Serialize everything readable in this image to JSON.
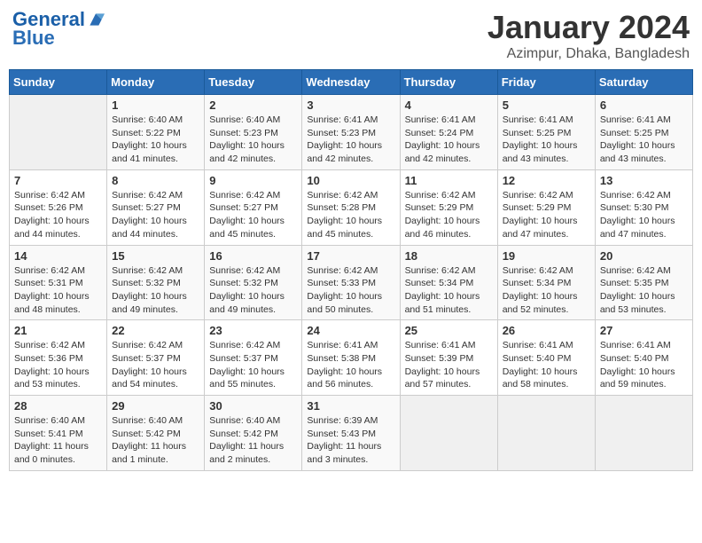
{
  "header": {
    "logo_line1": "General",
    "logo_line2": "Blue",
    "main_title": "January 2024",
    "subtitle": "Azimpur, Dhaka, Bangladesh"
  },
  "weekdays": [
    "Sunday",
    "Monday",
    "Tuesday",
    "Wednesday",
    "Thursday",
    "Friday",
    "Saturday"
  ],
  "weeks": [
    [
      {
        "day": "",
        "info": ""
      },
      {
        "day": "1",
        "info": "Sunrise: 6:40 AM\nSunset: 5:22 PM\nDaylight: 10 hours\nand 41 minutes."
      },
      {
        "day": "2",
        "info": "Sunrise: 6:40 AM\nSunset: 5:23 PM\nDaylight: 10 hours\nand 42 minutes."
      },
      {
        "day": "3",
        "info": "Sunrise: 6:41 AM\nSunset: 5:23 PM\nDaylight: 10 hours\nand 42 minutes."
      },
      {
        "day": "4",
        "info": "Sunrise: 6:41 AM\nSunset: 5:24 PM\nDaylight: 10 hours\nand 42 minutes."
      },
      {
        "day": "5",
        "info": "Sunrise: 6:41 AM\nSunset: 5:25 PM\nDaylight: 10 hours\nand 43 minutes."
      },
      {
        "day": "6",
        "info": "Sunrise: 6:41 AM\nSunset: 5:25 PM\nDaylight: 10 hours\nand 43 minutes."
      }
    ],
    [
      {
        "day": "7",
        "info": "Sunrise: 6:42 AM\nSunset: 5:26 PM\nDaylight: 10 hours\nand 44 minutes."
      },
      {
        "day": "8",
        "info": "Sunrise: 6:42 AM\nSunset: 5:27 PM\nDaylight: 10 hours\nand 44 minutes."
      },
      {
        "day": "9",
        "info": "Sunrise: 6:42 AM\nSunset: 5:27 PM\nDaylight: 10 hours\nand 45 minutes."
      },
      {
        "day": "10",
        "info": "Sunrise: 6:42 AM\nSunset: 5:28 PM\nDaylight: 10 hours\nand 45 minutes."
      },
      {
        "day": "11",
        "info": "Sunrise: 6:42 AM\nSunset: 5:29 PM\nDaylight: 10 hours\nand 46 minutes."
      },
      {
        "day": "12",
        "info": "Sunrise: 6:42 AM\nSunset: 5:29 PM\nDaylight: 10 hours\nand 47 minutes."
      },
      {
        "day": "13",
        "info": "Sunrise: 6:42 AM\nSunset: 5:30 PM\nDaylight: 10 hours\nand 47 minutes."
      }
    ],
    [
      {
        "day": "14",
        "info": "Sunrise: 6:42 AM\nSunset: 5:31 PM\nDaylight: 10 hours\nand 48 minutes."
      },
      {
        "day": "15",
        "info": "Sunrise: 6:42 AM\nSunset: 5:32 PM\nDaylight: 10 hours\nand 49 minutes."
      },
      {
        "day": "16",
        "info": "Sunrise: 6:42 AM\nSunset: 5:32 PM\nDaylight: 10 hours\nand 49 minutes."
      },
      {
        "day": "17",
        "info": "Sunrise: 6:42 AM\nSunset: 5:33 PM\nDaylight: 10 hours\nand 50 minutes."
      },
      {
        "day": "18",
        "info": "Sunrise: 6:42 AM\nSunset: 5:34 PM\nDaylight: 10 hours\nand 51 minutes."
      },
      {
        "day": "19",
        "info": "Sunrise: 6:42 AM\nSunset: 5:34 PM\nDaylight: 10 hours\nand 52 minutes."
      },
      {
        "day": "20",
        "info": "Sunrise: 6:42 AM\nSunset: 5:35 PM\nDaylight: 10 hours\nand 53 minutes."
      }
    ],
    [
      {
        "day": "21",
        "info": "Sunrise: 6:42 AM\nSunset: 5:36 PM\nDaylight: 10 hours\nand 53 minutes."
      },
      {
        "day": "22",
        "info": "Sunrise: 6:42 AM\nSunset: 5:37 PM\nDaylight: 10 hours\nand 54 minutes."
      },
      {
        "day": "23",
        "info": "Sunrise: 6:42 AM\nSunset: 5:37 PM\nDaylight: 10 hours\nand 55 minutes."
      },
      {
        "day": "24",
        "info": "Sunrise: 6:41 AM\nSunset: 5:38 PM\nDaylight: 10 hours\nand 56 minutes."
      },
      {
        "day": "25",
        "info": "Sunrise: 6:41 AM\nSunset: 5:39 PM\nDaylight: 10 hours\nand 57 minutes."
      },
      {
        "day": "26",
        "info": "Sunrise: 6:41 AM\nSunset: 5:40 PM\nDaylight: 10 hours\nand 58 minutes."
      },
      {
        "day": "27",
        "info": "Sunrise: 6:41 AM\nSunset: 5:40 PM\nDaylight: 10 hours\nand 59 minutes."
      }
    ],
    [
      {
        "day": "28",
        "info": "Sunrise: 6:40 AM\nSunset: 5:41 PM\nDaylight: 11 hours\nand 0 minutes."
      },
      {
        "day": "29",
        "info": "Sunrise: 6:40 AM\nSunset: 5:42 PM\nDaylight: 11 hours\nand 1 minute."
      },
      {
        "day": "30",
        "info": "Sunrise: 6:40 AM\nSunset: 5:42 PM\nDaylight: 11 hours\nand 2 minutes."
      },
      {
        "day": "31",
        "info": "Sunrise: 6:39 AM\nSunset: 5:43 PM\nDaylight: 11 hours\nand 3 minutes."
      },
      {
        "day": "",
        "info": ""
      },
      {
        "day": "",
        "info": ""
      },
      {
        "day": "",
        "info": ""
      }
    ]
  ]
}
